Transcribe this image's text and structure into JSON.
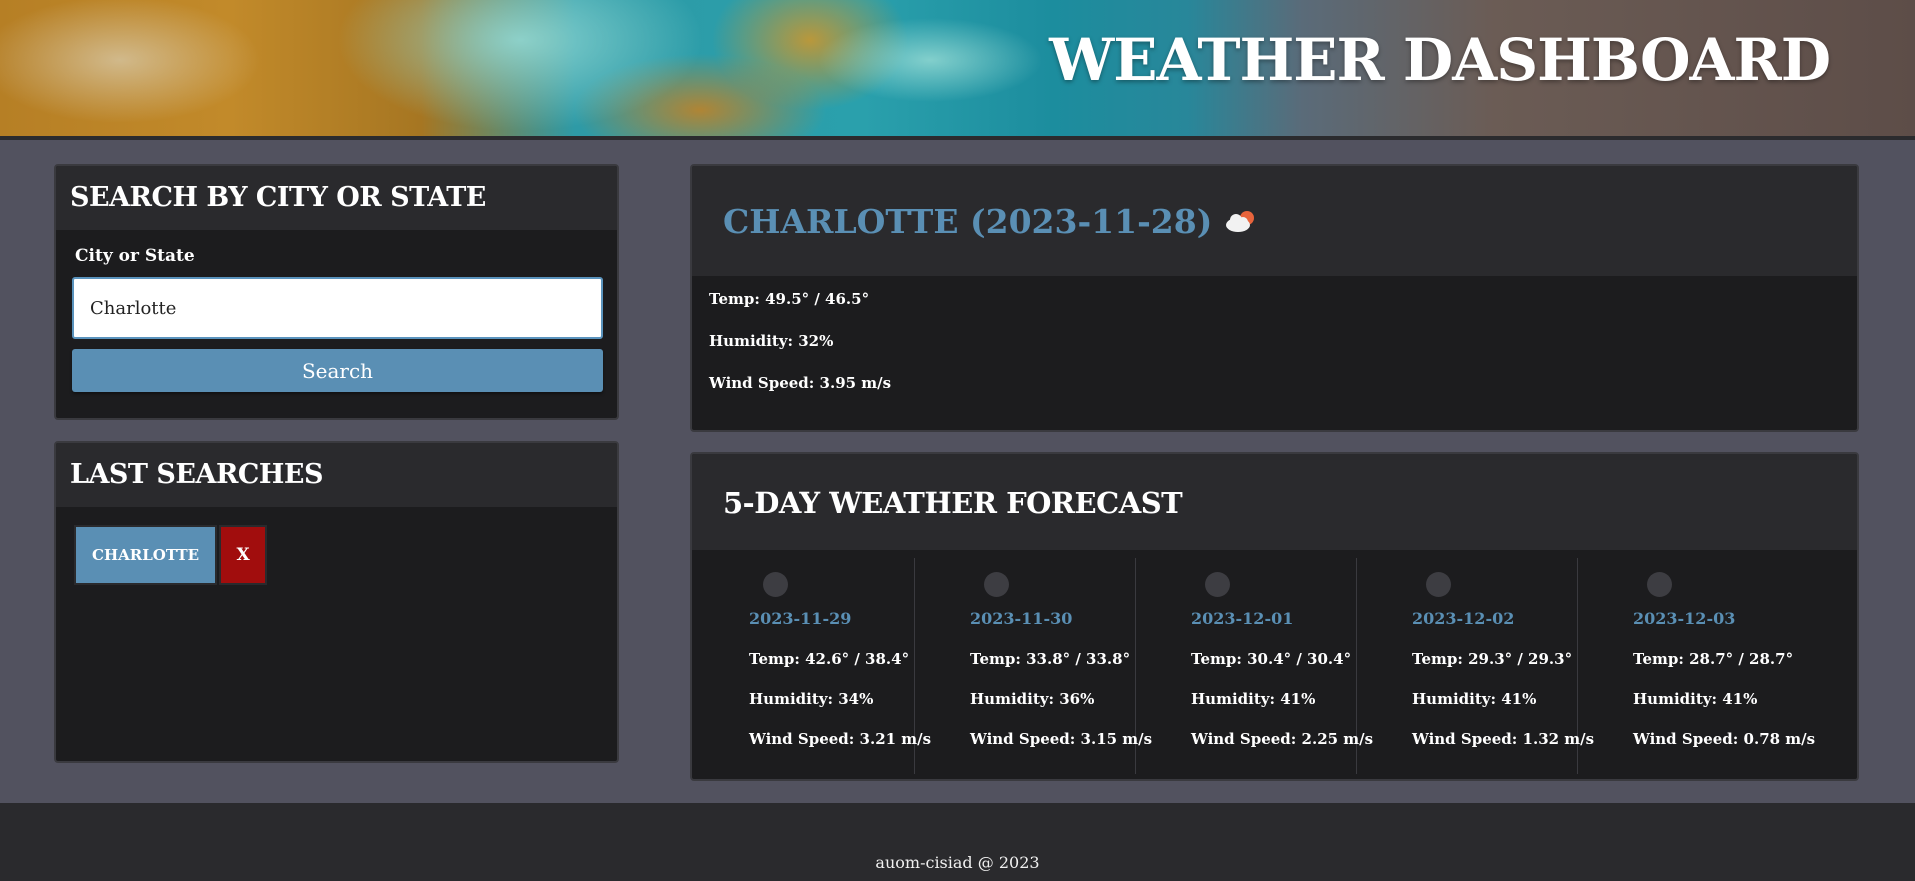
{
  "header": {
    "title": "WEATHER DASHBOARD"
  },
  "search": {
    "heading": "SEARCH BY CITY OR STATE",
    "field_label": "City or State",
    "value": "Charlotte",
    "button_label": "Search"
  },
  "history": {
    "heading": "LAST SEARCHES",
    "items": [
      {
        "label": "CHARLOTTE",
        "delete_label": "X"
      }
    ]
  },
  "current": {
    "title": "CHARLOTTE (2023-11-28)",
    "icon": "cloudy-sun-icon",
    "temp": "Temp: 49.5° / 46.5°",
    "humidity": "Humidity: 32%",
    "wind": "Wind Speed: 3.95 m/s"
  },
  "forecast": {
    "heading": "5-DAY WEATHER FORECAST",
    "days": [
      {
        "date": "2023-11-29",
        "temp": "Temp: 42.6° / 38.4°",
        "humidity": "Humidity: 34%",
        "wind": "Wind Speed: 3.21 m/s"
      },
      {
        "date": "2023-11-30",
        "temp": "Temp: 33.8° / 33.8°",
        "humidity": "Humidity: 36%",
        "wind": "Wind Speed: 3.15 m/s"
      },
      {
        "date": "2023-12-01",
        "temp": "Temp: 30.4° / 30.4°",
        "humidity": "Humidity: 41%",
        "wind": "Wind Speed: 2.25 m/s"
      },
      {
        "date": "2023-12-02",
        "temp": "Temp: 29.3° / 29.3°",
        "humidity": "Humidity: 41%",
        "wind": "Wind Speed: 1.32 m/s"
      },
      {
        "date": "2023-12-03",
        "temp": "Temp: 28.7° / 28.7°",
        "humidity": "Humidity: 41%",
        "wind": "Wind Speed: 0.78 m/s"
      }
    ]
  },
  "footer": {
    "text": "auom-cisiad @ 2023"
  },
  "colors": {
    "accent": "#5a8fb4",
    "danger": "#a10d0d",
    "background": "#52525f",
    "panel": "#1c1c1e"
  }
}
